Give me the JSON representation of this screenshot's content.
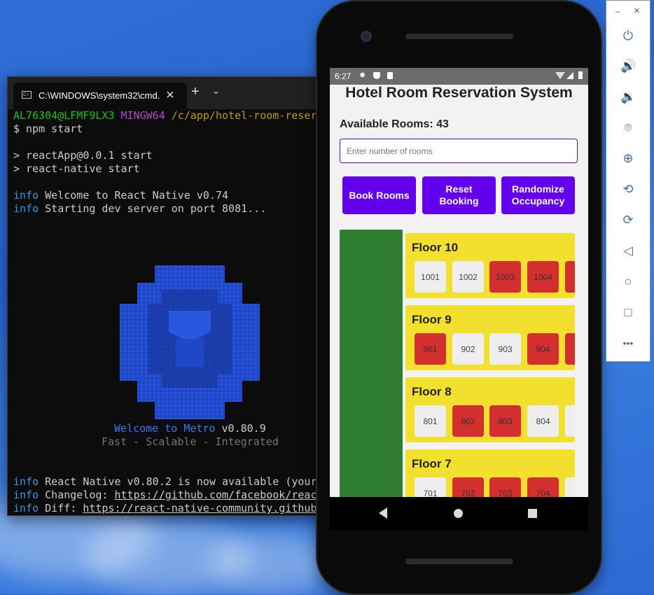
{
  "terminal": {
    "tab_title": "C:\\WINDOWS\\system32\\cmd.",
    "prompt_user": "AL76304@LFMF9LX3",
    "prompt_env": "MINGW64",
    "prompt_path": "/c/app/hotel-room-reserv",
    "command": "$ npm start",
    "lines": {
      "start1": "> reactApp@0.0.1 start",
      "start2": "> react-native start",
      "info_prefix": "info",
      "welcome": "Welcome to React Native v0.74",
      "starting": "Starting dev server on port 8081...",
      "metro_welcome": "Welcome to Metro",
      "metro_version": "v0.80.9",
      "metro_tagline": "Fast - Scalable - Integrated",
      "update": "React Native v0.80.2 is now available (your",
      "changelog_label": "Changelog:",
      "changelog_url": "https://github.com/facebook/react",
      "diff_label": "Diff:",
      "diff_url": "https://react-native-community.github"
    }
  },
  "phone": {
    "status_time": "6:27",
    "app": {
      "title": "Hotel Room Reservation System",
      "available_label": "Available Rooms: 43",
      "input_placeholder": "Enter number of rooms",
      "buttons": {
        "book": "Book Rooms",
        "reset": "Reset Booking",
        "randomize": "Randomize Occupancy"
      },
      "floors": [
        {
          "title": "Floor 10",
          "rooms": [
            {
              "n": "1001",
              "booked": false
            },
            {
              "n": "1002",
              "booked": false
            },
            {
              "n": "1003",
              "booked": true
            },
            {
              "n": "1004",
              "booked": true
            }
          ],
          "edge": "booked"
        },
        {
          "title": "Floor 9",
          "rooms": [
            {
              "n": "901",
              "booked": true
            },
            {
              "n": "902",
              "booked": false
            },
            {
              "n": "903",
              "booked": false
            },
            {
              "n": "904",
              "booked": true
            }
          ],
          "edge": "booked"
        },
        {
          "title": "Floor 8",
          "rooms": [
            {
              "n": "801",
              "booked": false
            },
            {
              "n": "802",
              "booked": true
            },
            {
              "n": "803",
              "booked": true
            },
            {
              "n": "804",
              "booked": false
            }
          ],
          "edge": "free"
        },
        {
          "title": "Floor 7",
          "rooms": [
            {
              "n": "701",
              "booked": false
            },
            {
              "n": "702",
              "booked": true
            },
            {
              "n": "703",
              "booked": true
            },
            {
              "n": "704",
              "booked": true
            }
          ],
          "edge": "free"
        }
      ]
    }
  },
  "emulator_toolbar": {
    "minimize": "–",
    "close": "×",
    "icons": [
      "power-icon",
      "volume-up-icon",
      "volume-down-icon",
      "camera-icon",
      "zoom-icon",
      "rotate-left-icon",
      "rotate-right-icon",
      "back-icon",
      "home-icon",
      "overview-icon",
      "more-icon"
    ]
  },
  "colors": {
    "accent": "#6200ee",
    "floor_bg": "#f2df2e",
    "booked": "#d32f2f",
    "free": "#eeeeee",
    "sidebar_green": "#2e7d32"
  }
}
